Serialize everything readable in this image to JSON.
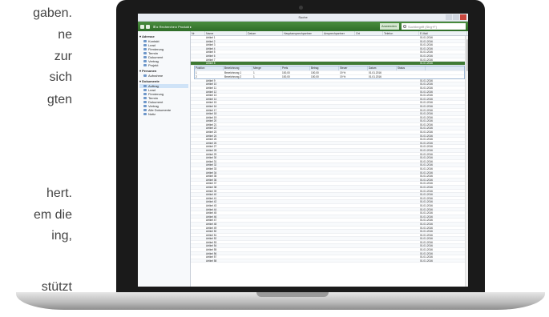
{
  "background_text": [
    "gaben.",
    "ne",
    "zur",
    "sich",
    "gten",
    "hert.",
    "em die",
    "ing,",
    "stützt"
  ],
  "window": {
    "title": "Suche"
  },
  "ribbon": {
    "breadcrumb": "⊞ ▸ Recherche ▸ Produkt ▸",
    "search_button": "Anwenden",
    "search_placeholder": "Suchbegriff (Strg+F)"
  },
  "sidebar": {
    "groups": [
      {
        "label": "Adresse",
        "items": [
          "Kontakt",
          "Lead",
          "Firmierung",
          "Termin",
          "Dokument",
          "Vertrag",
          "Projekt"
        ]
      },
      {
        "label": "Personen",
        "items": [
          "Aufnahme"
        ]
      },
      {
        "label": "Dokumente",
        "items": [
          "Auftrag",
          "Lead",
          "Firmierung",
          "Termin",
          "Dokument",
          "Vertrag",
          "Alle Dokumente",
          "Notiz"
        ]
      }
    ],
    "selected": "Auftrag"
  },
  "table": {
    "headers": [
      "Nr",
      "Name",
      "Datum",
      "Hauptansprechpartner",
      "Ansprechpartner",
      "Ort",
      "Telefon",
      "E-Mail"
    ],
    "rows_top": [
      [
        "",
        "Artikel 1",
        "",
        "",
        "",
        "",
        "",
        "01.01.2016"
      ],
      [
        "",
        "Artikel 2",
        "",
        "",
        "",
        "",
        "",
        "01.01.2016"
      ],
      [
        "",
        "Artikel 3",
        "",
        "",
        "",
        "",
        "",
        "01.01.2016"
      ],
      [
        "",
        "Artikel 4",
        "",
        "",
        "",
        "",
        "",
        "01.01.2016"
      ],
      [
        "",
        "Artikel 5",
        "",
        "",
        "",
        "",
        "",
        "01.01.2016"
      ],
      [
        "",
        "Artikel 6",
        "",
        "",
        "",
        "",
        "",
        "01.01.2016"
      ],
      [
        "",
        "Artikel 7",
        "",
        "",
        "",
        "",
        "",
        "01.01.2016"
      ]
    ],
    "selected_row": [
      "",
      "Artikel 8",
      "",
      "",
      "",
      "",
      "",
      "01.01.2016"
    ],
    "subtable": {
      "headers": [
        "Position",
        "Bezeichnung",
        "Menge",
        "Preis",
        "Betrag",
        "Steuer",
        "Datum",
        "Status"
      ],
      "rows": [
        [
          "1",
          "Bezeichnung 1",
          "1",
          "100,00",
          "100,00",
          "19 %",
          "01.01.2016",
          ""
        ],
        [
          "2",
          "Bezeichnung 2",
          "1",
          "100,00",
          "100,00",
          "19 %",
          "01.01.2016",
          ""
        ]
      ]
    },
    "rows_bottom": [
      [
        "",
        "Artikel 9",
        "",
        "",
        "",
        "",
        "",
        "01.01.2016"
      ],
      [
        "",
        "Artikel 10",
        "",
        "",
        "",
        "",
        "",
        "01.01.2016"
      ],
      [
        "",
        "Artikel 11",
        "",
        "",
        "",
        "",
        "",
        "01.01.2016"
      ],
      [
        "",
        "Artikel 12",
        "",
        "",
        "",
        "",
        "",
        "01.01.2016"
      ],
      [
        "",
        "Artikel 13",
        "",
        "",
        "",
        "",
        "",
        "01.01.2016"
      ],
      [
        "",
        "Artikel 14",
        "",
        "",
        "",
        "",
        "",
        "01.01.2016"
      ],
      [
        "",
        "Artikel 15",
        "",
        "",
        "",
        "",
        "",
        "01.01.2016"
      ],
      [
        "",
        "Artikel 16",
        "",
        "",
        "",
        "",
        "",
        "01.01.2016"
      ],
      [
        "",
        "Artikel 17",
        "",
        "",
        "",
        "",
        "",
        "01.01.2016"
      ],
      [
        "",
        "Artikel 18",
        "",
        "",
        "",
        "",
        "",
        "01.01.2016"
      ],
      [
        "",
        "Artikel 19",
        "",
        "",
        "",
        "",
        "",
        "01.01.2016"
      ],
      [
        "",
        "Artikel 20",
        "",
        "",
        "",
        "",
        "",
        "01.01.2016"
      ],
      [
        "",
        "Artikel 21",
        "",
        "",
        "",
        "",
        "",
        "01.01.2016"
      ],
      [
        "",
        "Artikel 22",
        "",
        "",
        "",
        "",
        "",
        "01.01.2016"
      ],
      [
        "",
        "Artikel 23",
        "",
        "",
        "",
        "",
        "",
        "01.01.2016"
      ],
      [
        "",
        "Artikel 24",
        "",
        "",
        "",
        "",
        "",
        "01.01.2016"
      ],
      [
        "",
        "Artikel 25",
        "",
        "",
        "",
        "",
        "",
        "01.01.2016"
      ],
      [
        "",
        "Artikel 26",
        "",
        "",
        "",
        "",
        "",
        "01.01.2016"
      ],
      [
        "",
        "Artikel 27",
        "",
        "",
        "",
        "",
        "",
        "01.01.2016"
      ],
      [
        "",
        "Artikel 28",
        "",
        "",
        "",
        "",
        "",
        "01.01.2016"
      ],
      [
        "",
        "Artikel 29",
        "",
        "",
        "",
        "",
        "",
        "01.01.2016"
      ],
      [
        "",
        "Artikel 30",
        "",
        "",
        "",
        "",
        "",
        "01.01.2016"
      ],
      [
        "",
        "Artikel 31",
        "",
        "",
        "",
        "",
        "",
        "01.01.2016"
      ],
      [
        "",
        "Artikel 32",
        "",
        "",
        "",
        "",
        "",
        "01.01.2016"
      ],
      [
        "",
        "Artikel 33",
        "",
        "",
        "",
        "",
        "",
        "01.01.2016"
      ],
      [
        "",
        "Artikel 34",
        "",
        "",
        "",
        "",
        "",
        "01.01.2016"
      ],
      [
        "",
        "Artikel 35",
        "",
        "",
        "",
        "",
        "",
        "01.01.2016"
      ],
      [
        "",
        "Artikel 36",
        "",
        "",
        "",
        "",
        "",
        "01.01.2016"
      ],
      [
        "",
        "Artikel 37",
        "",
        "",
        "",
        "",
        "",
        "01.01.2016"
      ],
      [
        "",
        "Artikel 38",
        "",
        "",
        "",
        "",
        "",
        "01.01.2016"
      ],
      [
        "",
        "Artikel 39",
        "",
        "",
        "",
        "",
        "",
        "01.01.2016"
      ],
      [
        "",
        "Artikel 40",
        "",
        "",
        "",
        "",
        "",
        "01.01.2016"
      ],
      [
        "",
        "Artikel 41",
        "",
        "",
        "",
        "",
        "",
        "01.01.2016"
      ],
      [
        "",
        "Artikel 42",
        "",
        "",
        "",
        "",
        "",
        "01.01.2016"
      ],
      [
        "",
        "Artikel 43",
        "",
        "",
        "",
        "",
        "",
        "01.01.2016"
      ],
      [
        "",
        "Artikel 44",
        "",
        "",
        "",
        "",
        "",
        "01.01.2016"
      ],
      [
        "",
        "Artikel 45",
        "",
        "",
        "",
        "",
        "",
        "01.01.2016"
      ],
      [
        "",
        "Artikel 46",
        "",
        "",
        "",
        "",
        "",
        "01.01.2016"
      ],
      [
        "",
        "Artikel 47",
        "",
        "",
        "",
        "",
        "",
        "01.01.2016"
      ],
      [
        "",
        "Artikel 48",
        "",
        "",
        "",
        "",
        "",
        "01.01.2016"
      ],
      [
        "",
        "Artikel 49",
        "",
        "",
        "",
        "",
        "",
        "01.01.2016"
      ],
      [
        "",
        "Artikel 50",
        "",
        "",
        "",
        "",
        "",
        "01.01.2016"
      ],
      [
        "",
        "Artikel 51",
        "",
        "",
        "",
        "",
        "",
        "01.01.2016"
      ],
      [
        "",
        "Artikel 52",
        "",
        "",
        "",
        "",
        "",
        "01.01.2016"
      ],
      [
        "",
        "Artikel 53",
        "",
        "",
        "",
        "",
        "",
        "01.01.2016"
      ],
      [
        "",
        "Artikel 54",
        "",
        "",
        "",
        "",
        "",
        "01.01.2016"
      ],
      [
        "",
        "Artikel 55",
        "",
        "",
        "",
        "",
        "",
        "01.01.2016"
      ],
      [
        "",
        "Artikel 56",
        "",
        "",
        "",
        "",
        "",
        "01.01.2016"
      ],
      [
        "",
        "Artikel 57",
        "",
        "",
        "",
        "",
        "",
        "01.01.2016"
      ],
      [
        "",
        "Artikel 58",
        "",
        "",
        "",
        "",
        "",
        "01.01.2016"
      ]
    ]
  },
  "colors": {
    "ribbon": "#2f6d28",
    "selected_row": "#3f7a34",
    "accent": "#6d96c9"
  }
}
